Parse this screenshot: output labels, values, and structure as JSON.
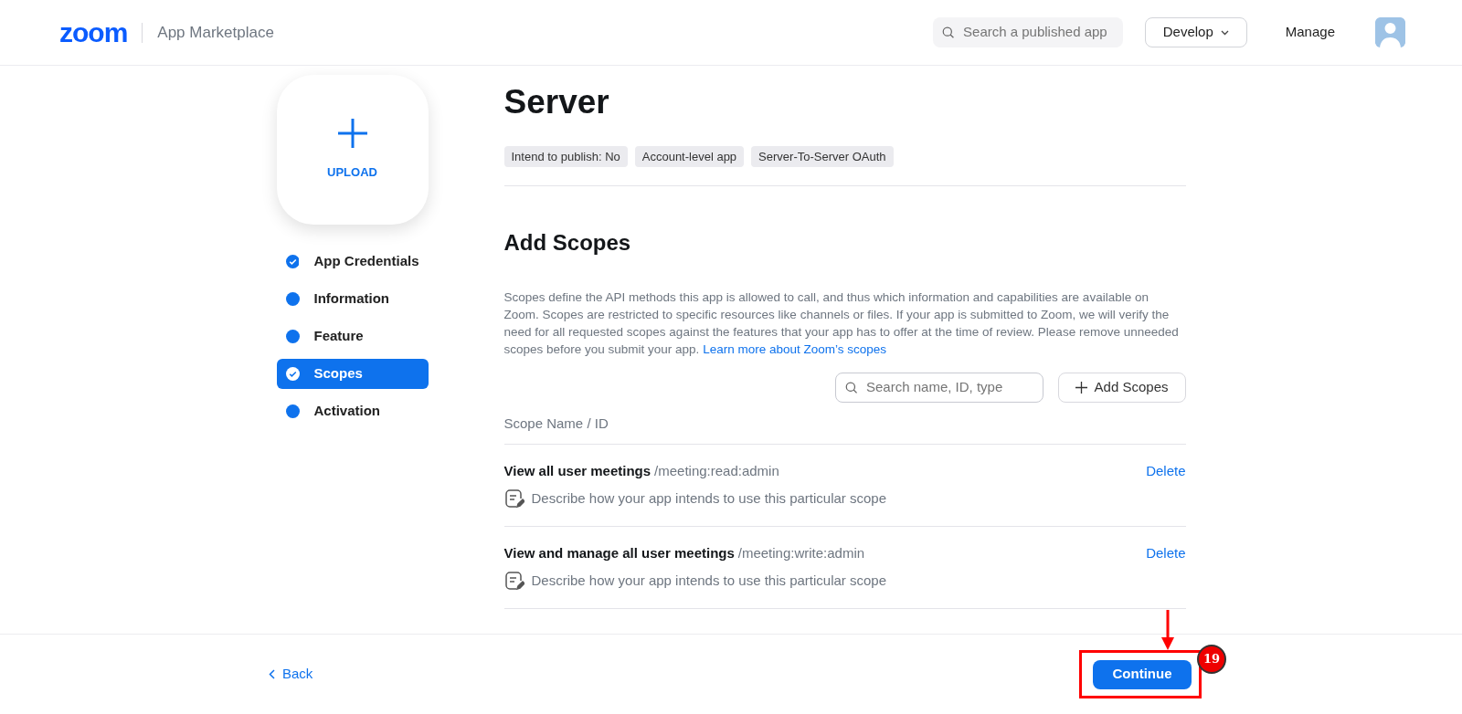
{
  "header": {
    "logo": "zoom",
    "title": "App Marketplace",
    "search": {
      "placeholder": "Search a published app"
    },
    "develop_button": "Develop",
    "manage_link": "Manage"
  },
  "upload": {
    "label": "UPLOAD"
  },
  "steps": [
    {
      "label": "App Credentials",
      "completed": true,
      "selected": false
    },
    {
      "label": "Information",
      "completed": false,
      "selected": false
    },
    {
      "label": "Feature",
      "completed": false,
      "selected": false
    },
    {
      "label": "Scopes",
      "completed": true,
      "selected": true
    },
    {
      "label": "Activation",
      "completed": false,
      "selected": false
    }
  ],
  "app": {
    "title": "Server",
    "tags": [
      "Intend to publish: No",
      "Account-level app",
      "Server-To-Server OAuth"
    ]
  },
  "scopes_section": {
    "heading": "Add Scopes",
    "description": "Scopes define the API methods this app is allowed to call, and thus which information and capabilities are available on Zoom. Scopes are restricted to specific resources like channels or files. If your app is submitted to Zoom, we will verify the need for all requested scopes against the features that your app has to offer at the time of review. Please remove unneeded scopes before you submit your app.",
    "learn_more_link": "Learn more about Zoom’s scopes",
    "search": {
      "placeholder": "Search name, ID, type"
    },
    "add_button": "Add Scopes",
    "column_header": "Scope Name / ID",
    "rows": [
      {
        "name": "View all user meetings",
        "id": "/meeting:read:admin",
        "action": "Delete",
        "description_placeholder": "Describe how your app intends to use this particular scope"
      },
      {
        "name": "View and manage all user meetings",
        "id": "/meeting:write:admin",
        "action": "Delete",
        "description_placeholder": "Describe how your app intends to use this particular scope"
      }
    ]
  },
  "footer": {
    "back_link": "Back",
    "continue_button": "Continue"
  },
  "annotation": {
    "step_number": "19"
  }
}
